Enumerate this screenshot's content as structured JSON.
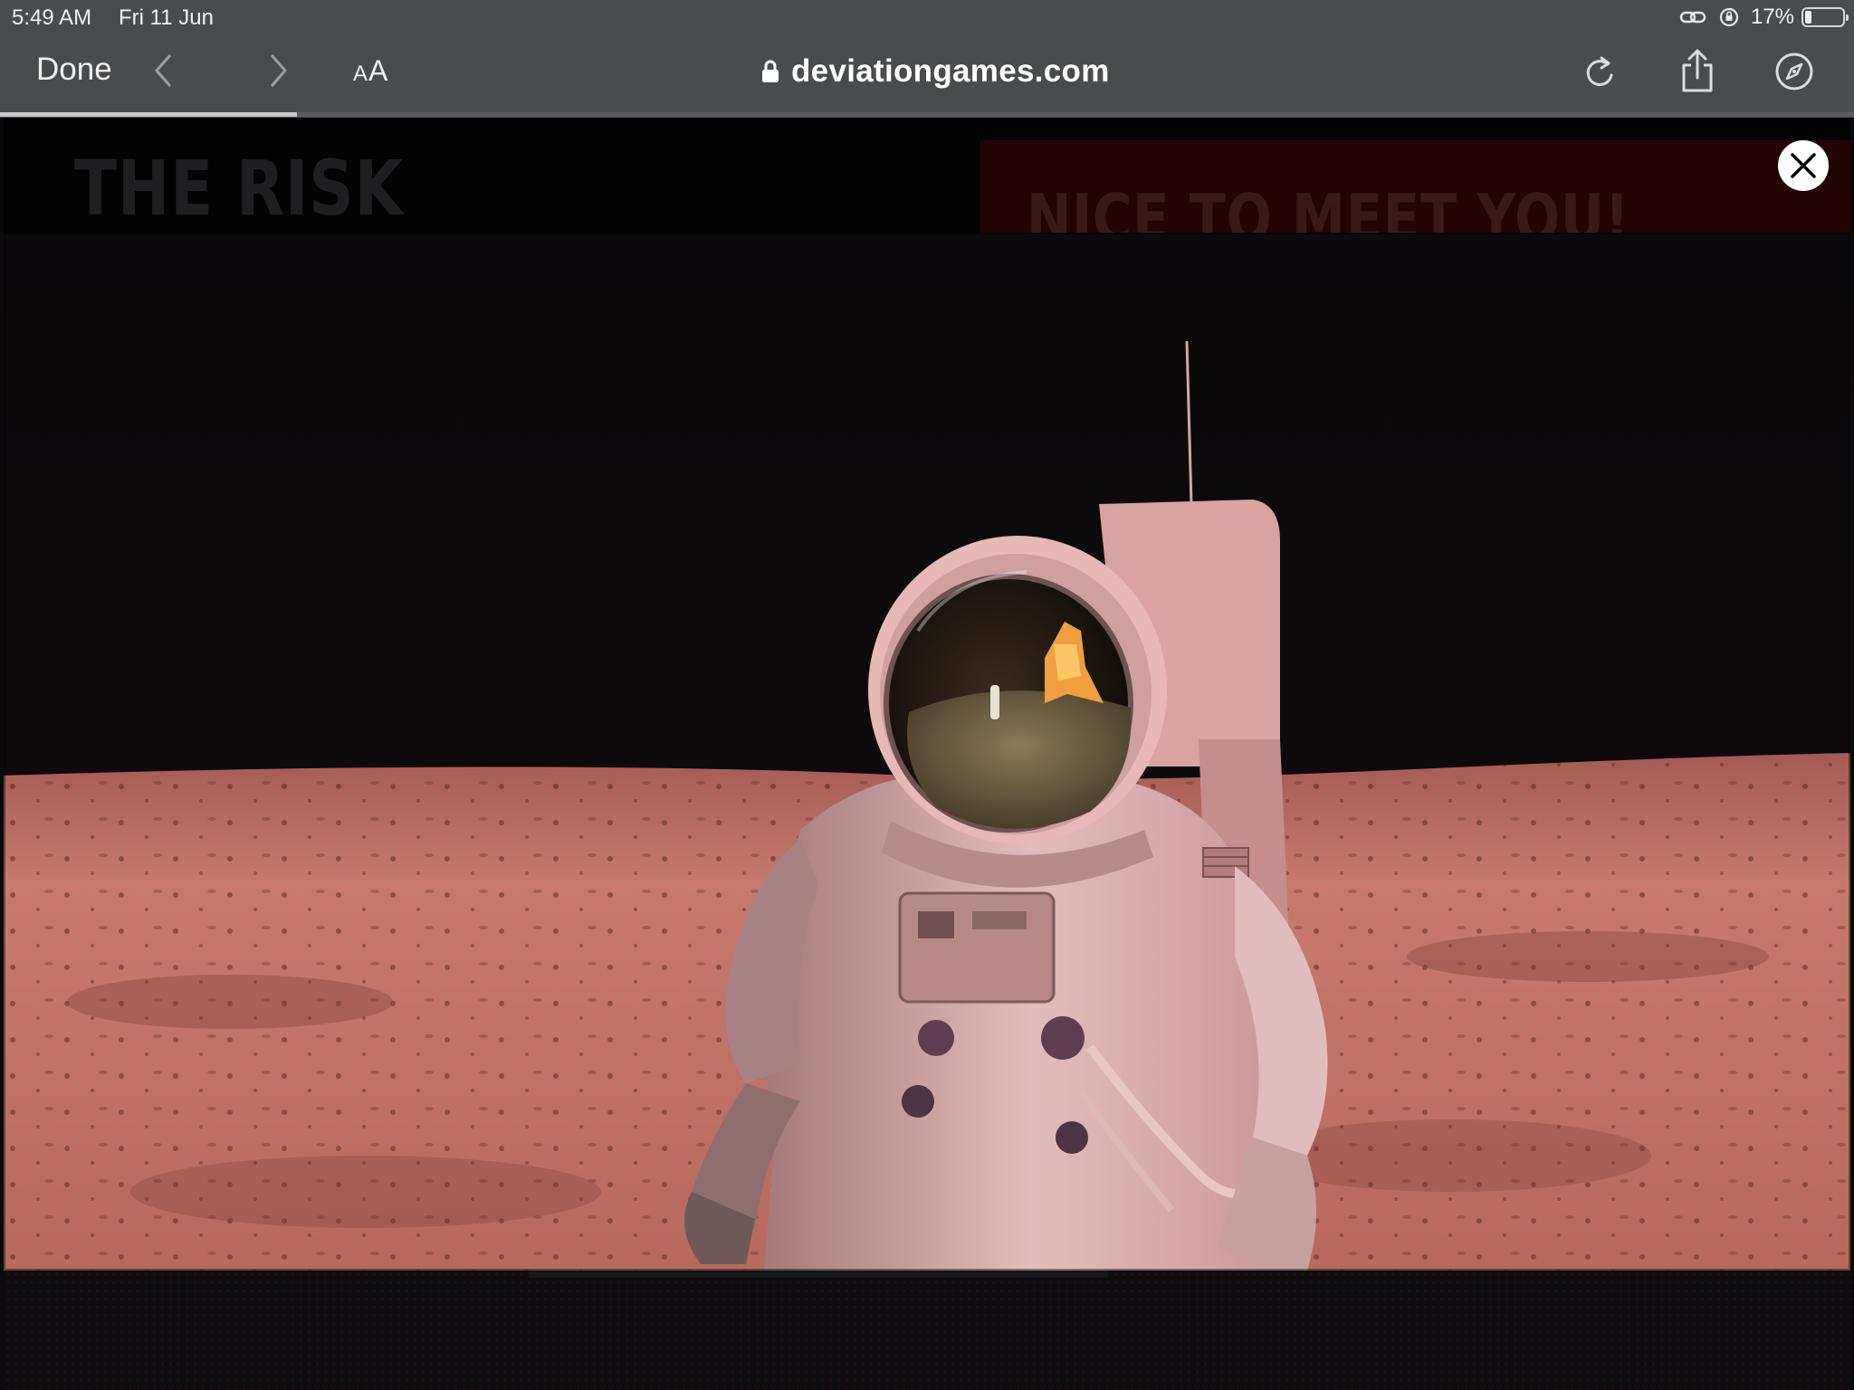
{
  "status_bar": {
    "time": "5:49 AM",
    "date": "Fri 11 Jun",
    "battery_percent": "17%",
    "battery_level": 0.17
  },
  "browser": {
    "done_label": "Done",
    "reader_label_small": "A",
    "reader_label_large": "A",
    "url": "deviationgames.com",
    "page_load_progress": 0.16,
    "icons": [
      "back-chevron-icon",
      "forward-chevron-icon",
      "lock-icon",
      "reload-icon",
      "share-icon",
      "compass-icon"
    ]
  },
  "page": {
    "heading_left": "THE RISK",
    "heading_right": "NICE TO MEET YOU!",
    "close_icon": "close-icon",
    "video_subject": "astronaut-on-moon"
  },
  "colors": {
    "chrome_bg": "#4a4b4f",
    "page_bg": "#080709",
    "accent_red": "#220404",
    "moon_surface": "#c9786c"
  }
}
